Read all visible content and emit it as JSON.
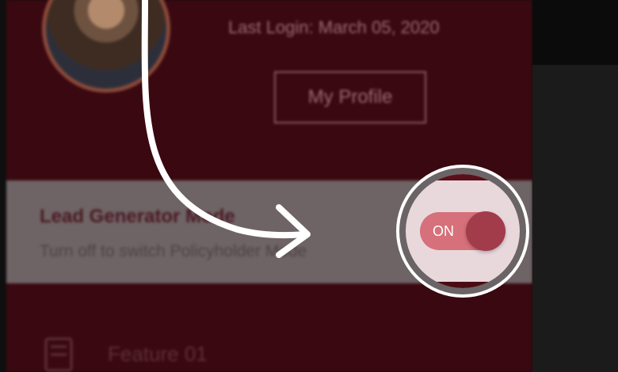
{
  "profile": {
    "last_login": "Last Login: March 05, 2020",
    "my_profile_label": "My Profile"
  },
  "mode": {
    "title": "Lead Generator Mode",
    "subtitle": "Turn off to switch Policyholder Mode",
    "toggle_label": "ON",
    "toggle_on": true
  },
  "features": [
    {
      "label": "Feature 01",
      "icon": "feature-grid-icon"
    }
  ],
  "colors": {
    "app_background": "#3a0810",
    "toggle_track": "#d6707a",
    "toggle_knob": "#a23c4a",
    "highlight_ring": "#ffffff"
  }
}
